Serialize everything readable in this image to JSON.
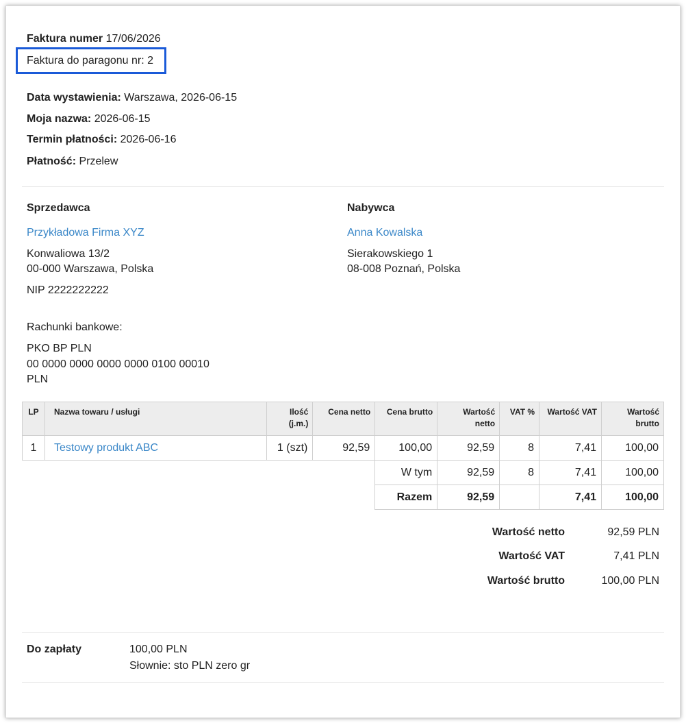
{
  "header": {
    "invoice_number_label": "Faktura numer",
    "invoice_number_value": "17/06/2026",
    "receipt_ref": "Faktura do paragonu nr: 2"
  },
  "meta": {
    "issue_date_label": "Data wystawienia:",
    "issue_date_value": "Warszawa, 2026-06-15",
    "my_name_label": "Moja nazwa:",
    "my_name_value": "2026-06-15",
    "due_date_label": "Termin płatności:",
    "due_date_value": "2026-06-16",
    "payment_label": "Płatność:",
    "payment_value": "Przelew"
  },
  "seller": {
    "heading": "Sprzedawca",
    "name": "Przykładowa Firma XYZ",
    "street": "Konwaliowa 13/2",
    "city": "00-000 Warszawa, Polska",
    "nip": "NIP 2222222222",
    "bank_heading": "Rachunki bankowe:",
    "bank_name": "PKO BP PLN",
    "bank_account": "00 0000 0000 0000 0000 0100 00010",
    "bank_currency": "PLN"
  },
  "buyer": {
    "heading": "Nabywca",
    "name": "Anna Kowalska",
    "street": "Sierakowskiego 1",
    "city": "08-008 Poznań, Polska"
  },
  "table": {
    "headers": {
      "lp": "LP",
      "name": "Nazwa towaru / usługi",
      "qty_1": "Ilość",
      "qty_2": "(j.m.)",
      "net_price": "Cena netto",
      "gross_price": "Cena brutto",
      "net_value_1": "Wartość",
      "net_value_2": "netto",
      "vat_pct": "VAT %",
      "vat_value": "Wartość VAT",
      "gross_value_1": "Wartość",
      "gross_value_2": "brutto"
    },
    "rows": [
      {
        "lp": "1",
        "name": "Testowy produkt ABC",
        "qty": "1 (szt)",
        "net_price": "92,59",
        "gross_price": "100,00",
        "net_value": "92,59",
        "vat_pct": "8",
        "vat_value": "7,41",
        "gross_value": "100,00"
      }
    ],
    "w_tym": {
      "label": "W tym",
      "net_value": "92,59",
      "vat_pct": "8",
      "vat_value": "7,41",
      "gross_value": "100,00"
    },
    "razem": {
      "label": "Razem",
      "net_value": "92,59",
      "vat_value": "7,41",
      "gross_value": "100,00"
    }
  },
  "summary": {
    "net_label": "Wartość netto",
    "net_value": "92,59 PLN",
    "vat_label": "Wartość VAT",
    "vat_value": "7,41 PLN",
    "gross_label": "Wartość brutto",
    "gross_value": "100,00 PLN"
  },
  "due": {
    "label": "Do zapłaty",
    "amount": "100,00 PLN",
    "words": "Słownie: sto PLN zero gr"
  }
}
